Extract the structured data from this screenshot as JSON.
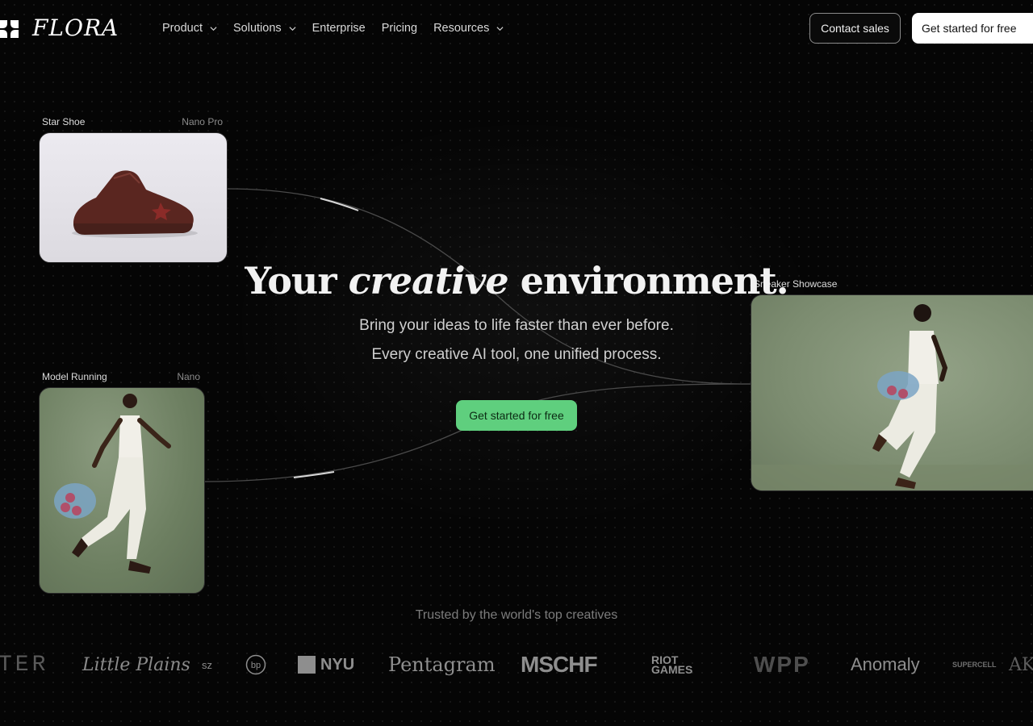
{
  "brand": {
    "name": "FLORA"
  },
  "nav": {
    "items": [
      {
        "label": "Product",
        "dropdown": true
      },
      {
        "label": "Solutions",
        "dropdown": true
      },
      {
        "label": "Enterprise",
        "dropdown": false
      },
      {
        "label": "Pricing",
        "dropdown": false
      },
      {
        "label": "Resources",
        "dropdown": true
      }
    ],
    "contact_label": "Contact sales",
    "get_started_label": "Get started for free"
  },
  "cards": {
    "star_shoe": {
      "title": "Star Shoe",
      "model": "Nano Pro"
    },
    "model_running": {
      "title": "Model Running",
      "model": "Nano"
    },
    "sneaker_showcase": {
      "title": "Sneaker Showcase"
    }
  },
  "hero": {
    "title_before": "Your",
    "title_em": "creative",
    "title_after": "environment.",
    "line1": "Bring your ideas to life faster than ever before.",
    "line2": "Every creative AI tool, one unified process.",
    "cta_label": "Get started for free"
  },
  "trusted": {
    "heading": "Trusted by the world's top creatives",
    "logos": [
      "TER",
      "Little Plains",
      "sz",
      "bp",
      "NYU",
      "Pentagram",
      "MSCHF",
      "RIOT GAMES",
      "WPP",
      "Anomaly",
      "SUPERCELL",
      "AKQ"
    ]
  },
  "colors": {
    "cta": "#5fcf7e",
    "background": "#050505",
    "white_button": "#ffffff"
  }
}
